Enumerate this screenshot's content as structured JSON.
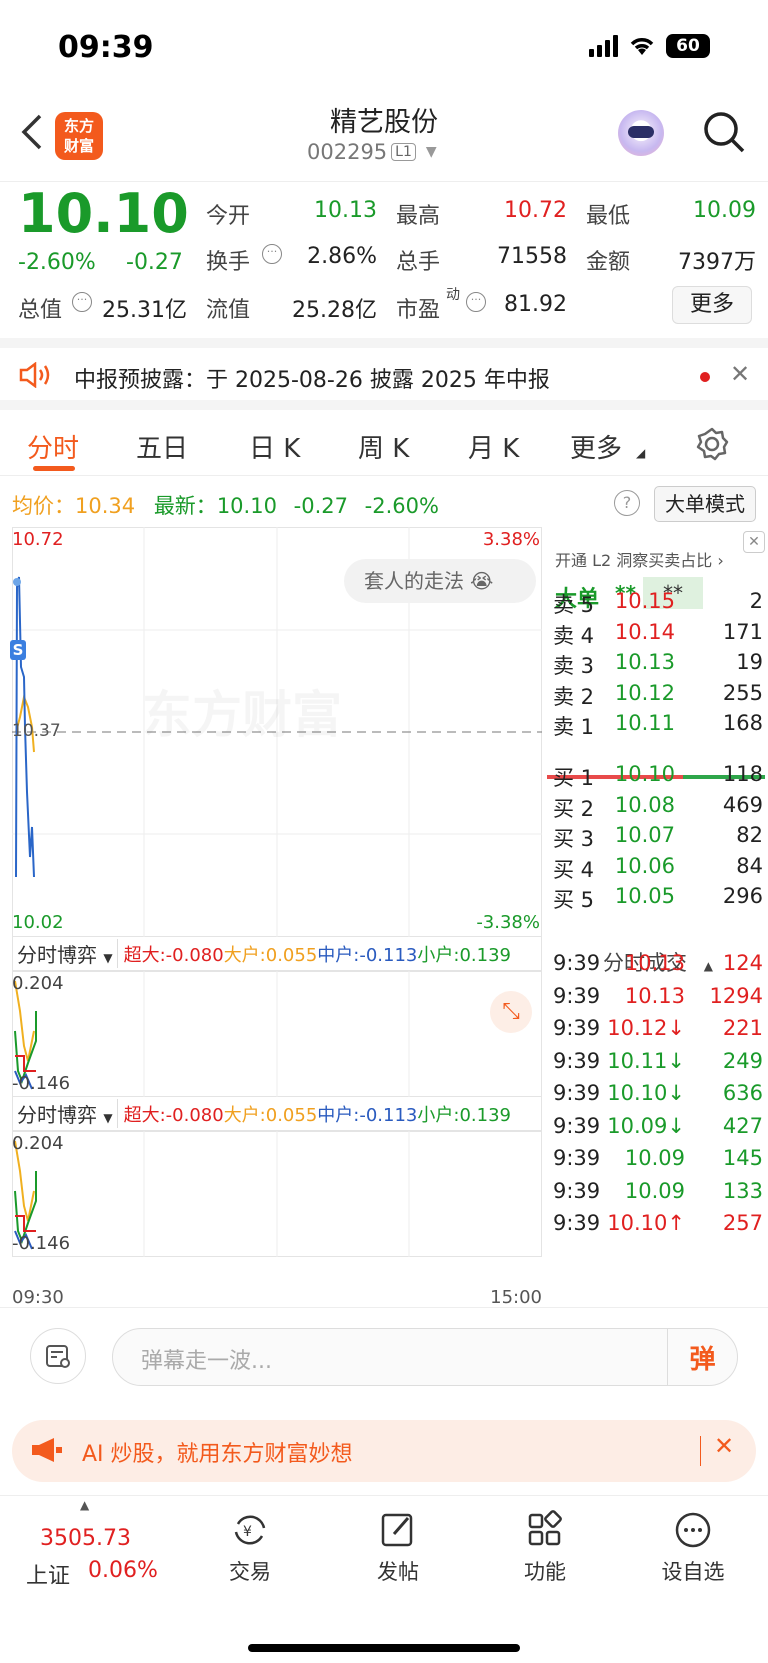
{
  "status": {
    "time": "09:39",
    "battery": "60"
  },
  "header": {
    "title": "精艺股份",
    "code": "002295",
    "level": "L1"
  },
  "quote": {
    "price": "10.10",
    "change_pct": "-2.60%",
    "change": "-0.27",
    "open_label": "今开",
    "open": "10.13",
    "high_label": "最高",
    "high": "10.72",
    "low_label": "最低",
    "low": "10.09",
    "turnover_label": "换手",
    "turnover": "2.86%",
    "volume_label": "总手",
    "volume": "71558",
    "amount_label": "金额",
    "amount": "7397万",
    "mcap_label": "总值",
    "mcap": "25.31亿",
    "float_label": "流值",
    "float": "25.28亿",
    "pe_label": "市盈",
    "pe_sup": "动",
    "pe": "81.92",
    "more": "更多"
  },
  "announce": {
    "text": "中报预披露：于 2025-08-26 披露 2025 年中报"
  },
  "tabs": [
    "分时",
    "五日",
    "日 K",
    "周 K",
    "月 K",
    "更多"
  ],
  "info": {
    "avg_label": "均价：",
    "avg": "10.34",
    "last_label": "最新：",
    "last": "10.10",
    "chg": "-0.27",
    "pct": "-2.60%",
    "mode": "大单模式"
  },
  "chart": {
    "ymax": "10.72",
    "ymin": "10.02",
    "pct_max": "3.38%",
    "pct_min": "-3.38%",
    "mid": "10.37",
    "watermark": "东方财富",
    "bubble": "套人的走法",
    "s_mark": "S",
    "t_start": "09:30",
    "t_end": "15:00"
  },
  "sub": {
    "title": "分时博弈",
    "super": "超大:-0.080",
    "big": "大户:0.055",
    "mid": "中户:-0.113",
    "small": "小户:0.139",
    "top": "0.204",
    "bottom": "-0.146"
  },
  "orderbook": {
    "l2": "开通 L2 洞察买卖占比",
    "big_label": "大单",
    "big_val": "**",
    "big_val2": "**",
    "sells": [
      {
        "l": "卖 5",
        "p": "10.15",
        "v": "2"
      },
      {
        "l": "卖 4",
        "p": "10.14",
        "v": "171"
      },
      {
        "l": "卖 3",
        "p": "10.13",
        "v": "19"
      },
      {
        "l": "卖 2",
        "p": "10.12",
        "v": "255"
      },
      {
        "l": "卖 1",
        "p": "10.11",
        "v": "168"
      }
    ],
    "buys": [
      {
        "l": "买 1",
        "p": "10.10",
        "v": "118"
      },
      {
        "l": "买 2",
        "p": "10.08",
        "v": "469"
      },
      {
        "l": "买 3",
        "p": "10.07",
        "v": "82"
      },
      {
        "l": "买 4",
        "p": "10.06",
        "v": "84"
      },
      {
        "l": "买 5",
        "p": "10.05",
        "v": "296"
      }
    ],
    "trades_title": "分时成交",
    "trades": [
      {
        "t": "9:39",
        "p": "10.13",
        "v": "124",
        "c": "red"
      },
      {
        "t": "9:39",
        "p": "10.13",
        "v": "1294",
        "c": "red"
      },
      {
        "t": "9:39",
        "p": "10.12↓",
        "v": "221",
        "c": "red"
      },
      {
        "t": "9:39",
        "p": "10.11↓",
        "v": "249",
        "c": "green"
      },
      {
        "t": "9:39",
        "p": "10.10↓",
        "v": "636",
        "c": "green"
      },
      {
        "t": "9:39",
        "p": "10.09↓",
        "v": "427",
        "c": "green"
      },
      {
        "t": "9:39",
        "p": "10.09",
        "v": "145",
        "c": "green"
      },
      {
        "t": "9:39",
        "p": "10.09",
        "v": "133",
        "c": "green"
      },
      {
        "t": "9:39",
        "p": "10.10↑",
        "v": "257",
        "c": "red"
      }
    ]
  },
  "danmu": {
    "placeholder": "弹幕走一波...",
    "btn": "弹"
  },
  "ad": {
    "text": "AI 炒股，就用东方财富妙想"
  },
  "bottom": {
    "index_val": "3505.73",
    "index_name": "上证",
    "index_pct": "0.06%",
    "trade": "交易",
    "post": "发帖",
    "func": "功能",
    "watch": "设自选"
  }
}
